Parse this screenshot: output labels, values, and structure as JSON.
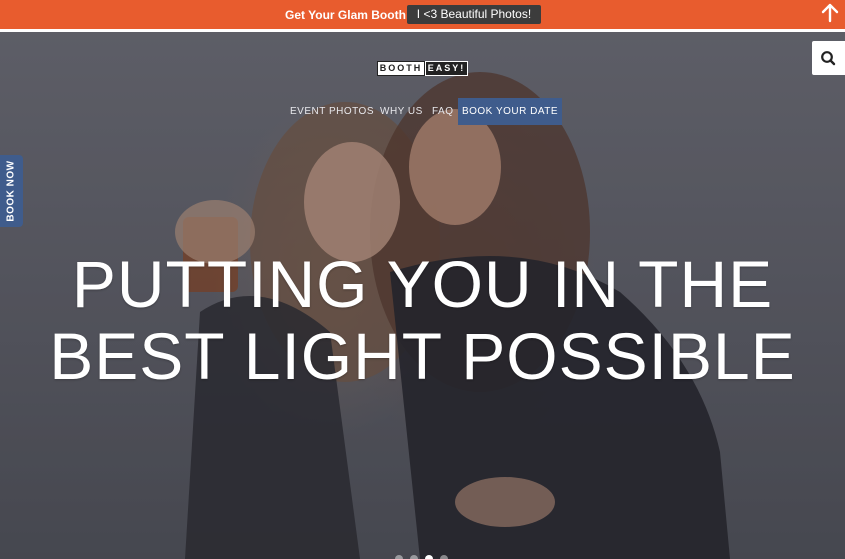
{
  "topbar": {
    "text": "Get Your Glam Booth!",
    "button_label": "I <3 Beautiful Photos!",
    "bg_color": "#e85c2e",
    "scroll_icon": "arrow-up-icon"
  },
  "logo": {
    "left": "BOOTH",
    "right": "EASY!"
  },
  "nav": {
    "items": [
      {
        "label": "EVENT PHOTOS"
      },
      {
        "label": "WHY US"
      },
      {
        "label": "FAQ"
      }
    ],
    "cta_label": "BOOK YOUR DATE",
    "cta_color": "#3f5c8c"
  },
  "search": {
    "icon": "search-icon"
  },
  "side_tab": {
    "label": "BOOK NOW",
    "color": "#3f5c8c"
  },
  "hero": {
    "headline_line1": "PUTTING YOU IN THE",
    "headline_line2": "BEST LIGHT POSSIBLE",
    "slides": {
      "count": 4,
      "active": 3
    }
  }
}
